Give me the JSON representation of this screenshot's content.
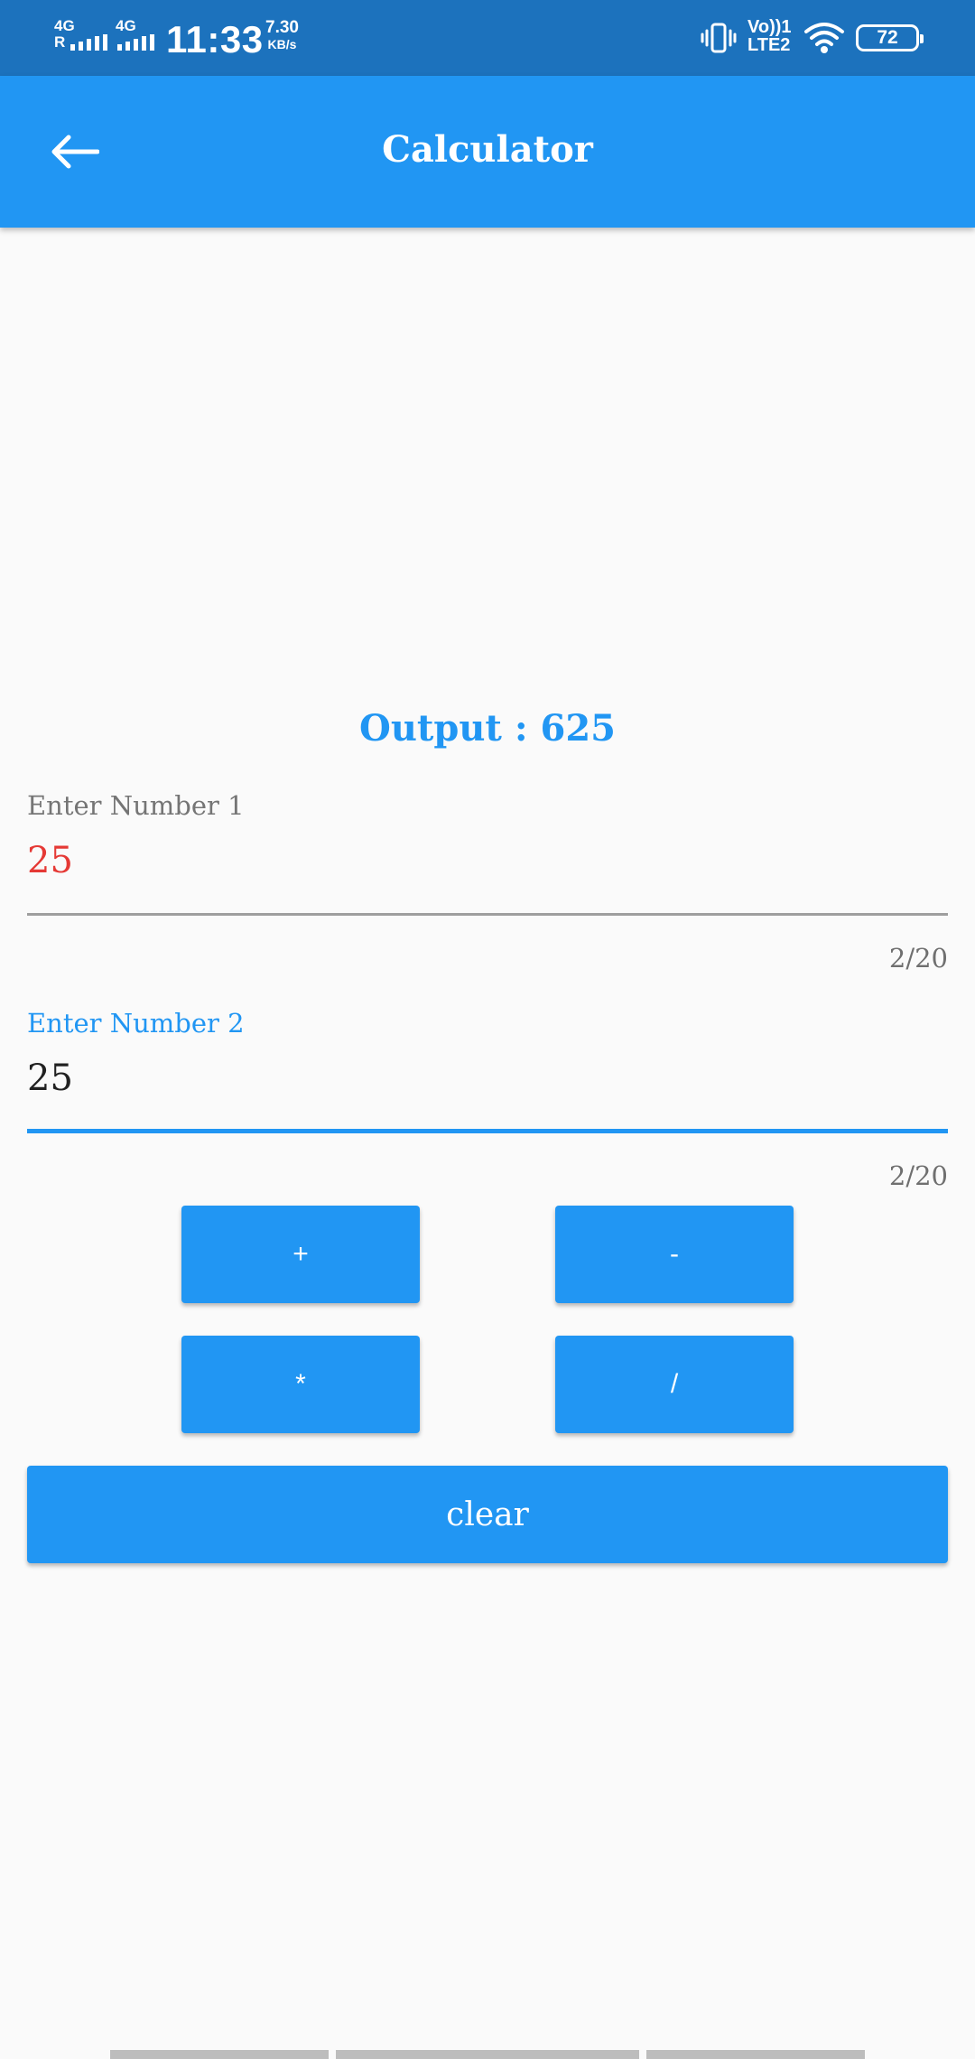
{
  "status_bar": {
    "net1": "4G",
    "net1_roaming": "R",
    "net2": "4G",
    "time": "11:33",
    "speed_value": "7.30",
    "speed_unit": "KB/s",
    "volte": "Vo))1",
    "lte": "LTE2",
    "battery": "72"
  },
  "app_bar": {
    "title": "Calculator",
    "back_icon": "arrow-back-icon"
  },
  "output": {
    "text": "Output : 625"
  },
  "field1": {
    "label": "Enter Number 1",
    "value": "25",
    "counter": "2/20",
    "value_color": "#e53935"
  },
  "field2": {
    "label": "Enter Number 2",
    "value": "25",
    "counter": "2/20",
    "focused": true
  },
  "buttons": {
    "add": "+",
    "subtract": "-",
    "multiply": "*",
    "divide": "/",
    "clear": "clear"
  },
  "colors": {
    "primary": "#2196f3",
    "status_bar": "#1c72bd",
    "error": "#e53935",
    "background": "#fafafa"
  }
}
